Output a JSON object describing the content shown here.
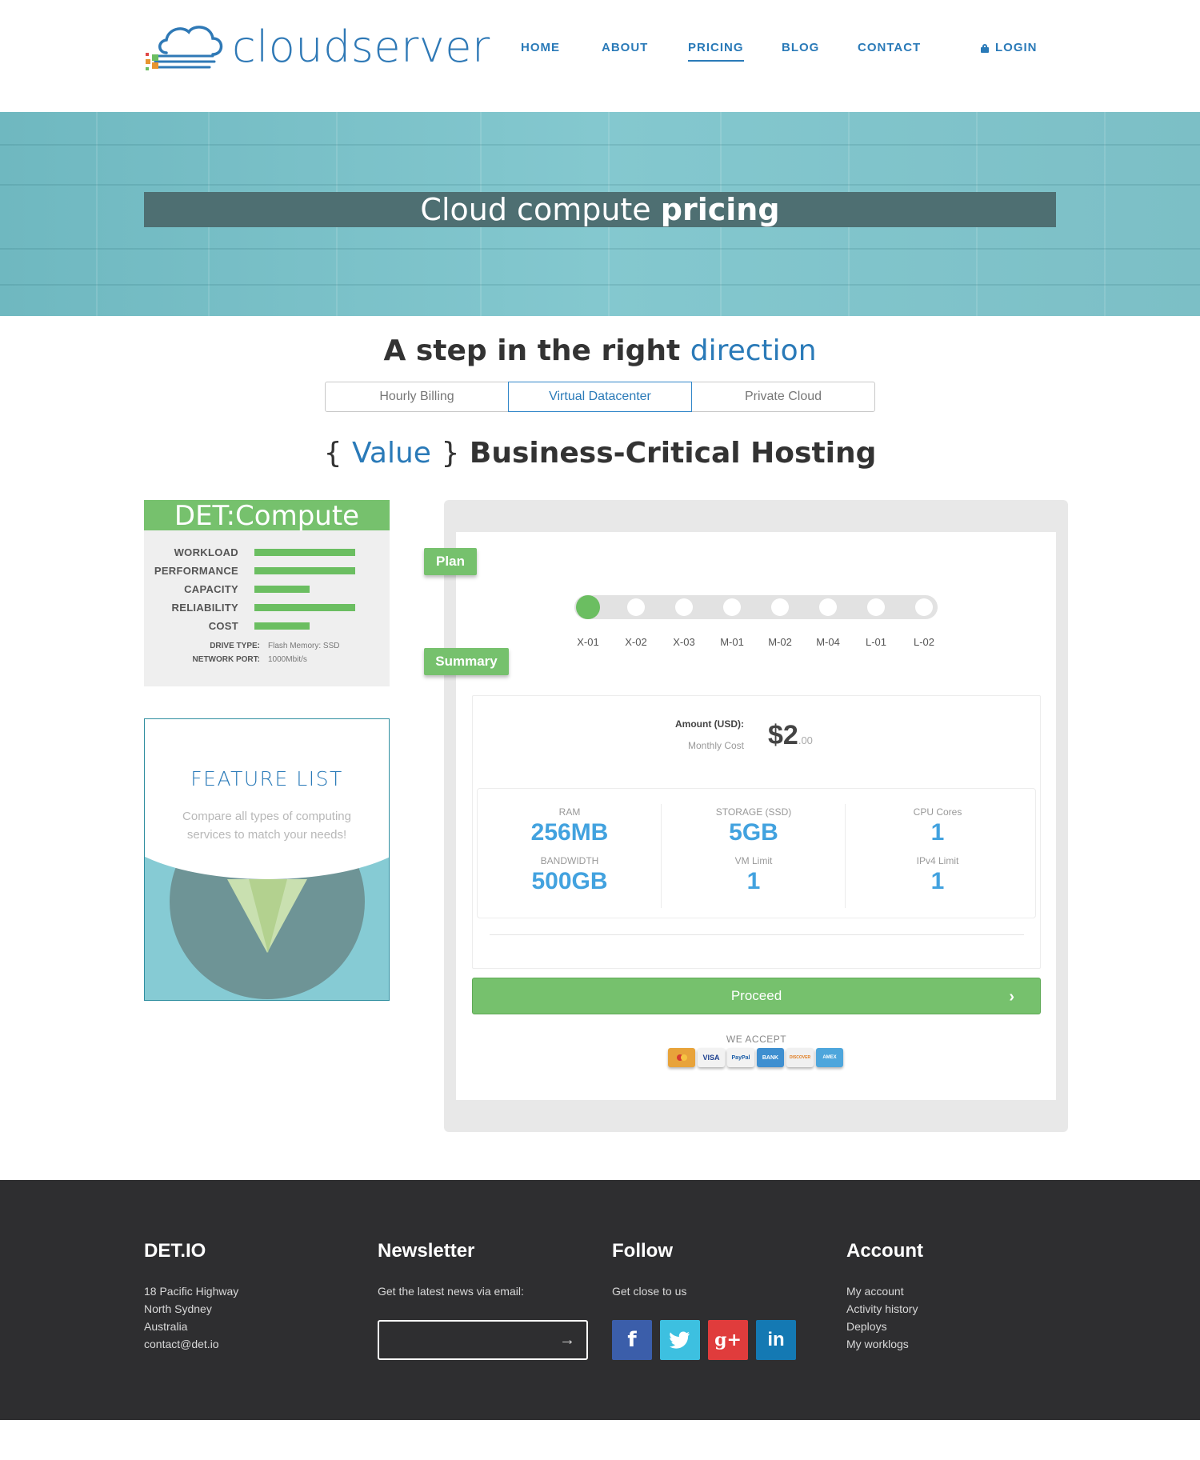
{
  "brand": {
    "name": "cloudserver"
  },
  "nav": {
    "items": [
      {
        "label": "HOME"
      },
      {
        "label": "ABOUT"
      },
      {
        "label": "PRICING",
        "active": true
      },
      {
        "label": "BLOG"
      },
      {
        "label": "CONTACT"
      }
    ],
    "login_label": "LOGIN"
  },
  "hero": {
    "title_light": "Cloud compute ",
    "title_bold": "pricing"
  },
  "step": {
    "title_bold": "A step in the right ",
    "title_accent": "direction"
  },
  "tabs": [
    {
      "label": "Hourly Billing"
    },
    {
      "label": "Virtual Datacenter",
      "selected": true
    },
    {
      "label": "Private Cloud"
    }
  ],
  "value_heading": {
    "open_brace": "{",
    "value_word": "Value",
    "close_brace": "}",
    "title": "Business-Critical Hosting"
  },
  "det_card": {
    "title": "DET:Compute",
    "metrics": [
      {
        "label": "WORKLOAD",
        "level": 1.0
      },
      {
        "label": "PERFORMANCE",
        "level": 1.0
      },
      {
        "label": "CAPACITY",
        "level": 0.55
      },
      {
        "label": "RELIABILITY",
        "level": 1.0
      },
      {
        "label": "COST",
        "level": 0.55
      }
    ],
    "specs": [
      {
        "key": "DRIVE TYPE:",
        "value": "Flash Memory: SSD"
      },
      {
        "key": "NETWORK PORT:",
        "value": "1000Mbit/s"
      }
    ]
  },
  "feature_list": {
    "title": "FEATURE LIST",
    "description": "Compare all types of computing services to match your needs!"
  },
  "calculator": {
    "plan_label": "Plan",
    "summary_label": "Summary",
    "plans": [
      "X-01",
      "X-02",
      "X-03",
      "M-01",
      "M-02",
      "M-04",
      "L-01",
      "L-02"
    ],
    "selected_plan": "X-01",
    "amount_label": "Amount (USD):",
    "amount_sub": "Monthly Cost",
    "amount_main": "$2",
    "amount_cents": ".00",
    "stats": [
      {
        "key": "RAM",
        "value": "256MB"
      },
      {
        "key": "STORAGE (SSD)",
        "value": "5GB"
      },
      {
        "key": "CPU Cores",
        "value": "1"
      },
      {
        "key": "BANDWIDTH",
        "value": "500GB"
      },
      {
        "key": "VM Limit",
        "value": "1"
      },
      {
        "key": "IPv4 Limit",
        "value": "1"
      }
    ],
    "proceed_label": "Proceed",
    "we_accept": "WE ACCEPT",
    "payment_cards": [
      {
        "name": "MasterCard",
        "color": "#e8a33a"
      },
      {
        "name": "VISA",
        "color": "#f2f2f2"
      },
      {
        "name": "PayPal",
        "color": "#f2f2f2"
      },
      {
        "name": "BANK",
        "color": "#3f8fd0"
      },
      {
        "name": "DISCOVER",
        "color": "#f0f0f0"
      },
      {
        "name": "AMEX",
        "color": "#4ea6dc"
      }
    ]
  },
  "footer": {
    "col1": {
      "title": "DET.IO",
      "lines": [
        "18 Pacific Highway",
        "North Sydney",
        "Australia",
        "contact@det.io"
      ]
    },
    "col2": {
      "title": "Newsletter",
      "text": "Get the latest news via email:",
      "input_placeholder": ""
    },
    "col3": {
      "title": "Follow",
      "text": "Get close to us",
      "socials": [
        {
          "icon": "facebook-icon",
          "glyph": "f",
          "color": "#3b5eaa"
        },
        {
          "icon": "twitter-icon",
          "glyph": "t",
          "color": "#3dc0e0"
        },
        {
          "icon": "google-plus-icon",
          "glyph": "g+",
          "color": "#e03c3c"
        },
        {
          "icon": "linkedin-icon",
          "glyph": "in",
          "color": "#1479b3"
        }
      ]
    },
    "col4": {
      "title": "Account",
      "lines": [
        "My account",
        "Activity history",
        "Deploys",
        "My worklogs"
      ]
    }
  },
  "colors": {
    "accent_blue": "#2a7ab8",
    "accent_green": "#76c16d",
    "footer_bg": "#2e2e30"
  }
}
